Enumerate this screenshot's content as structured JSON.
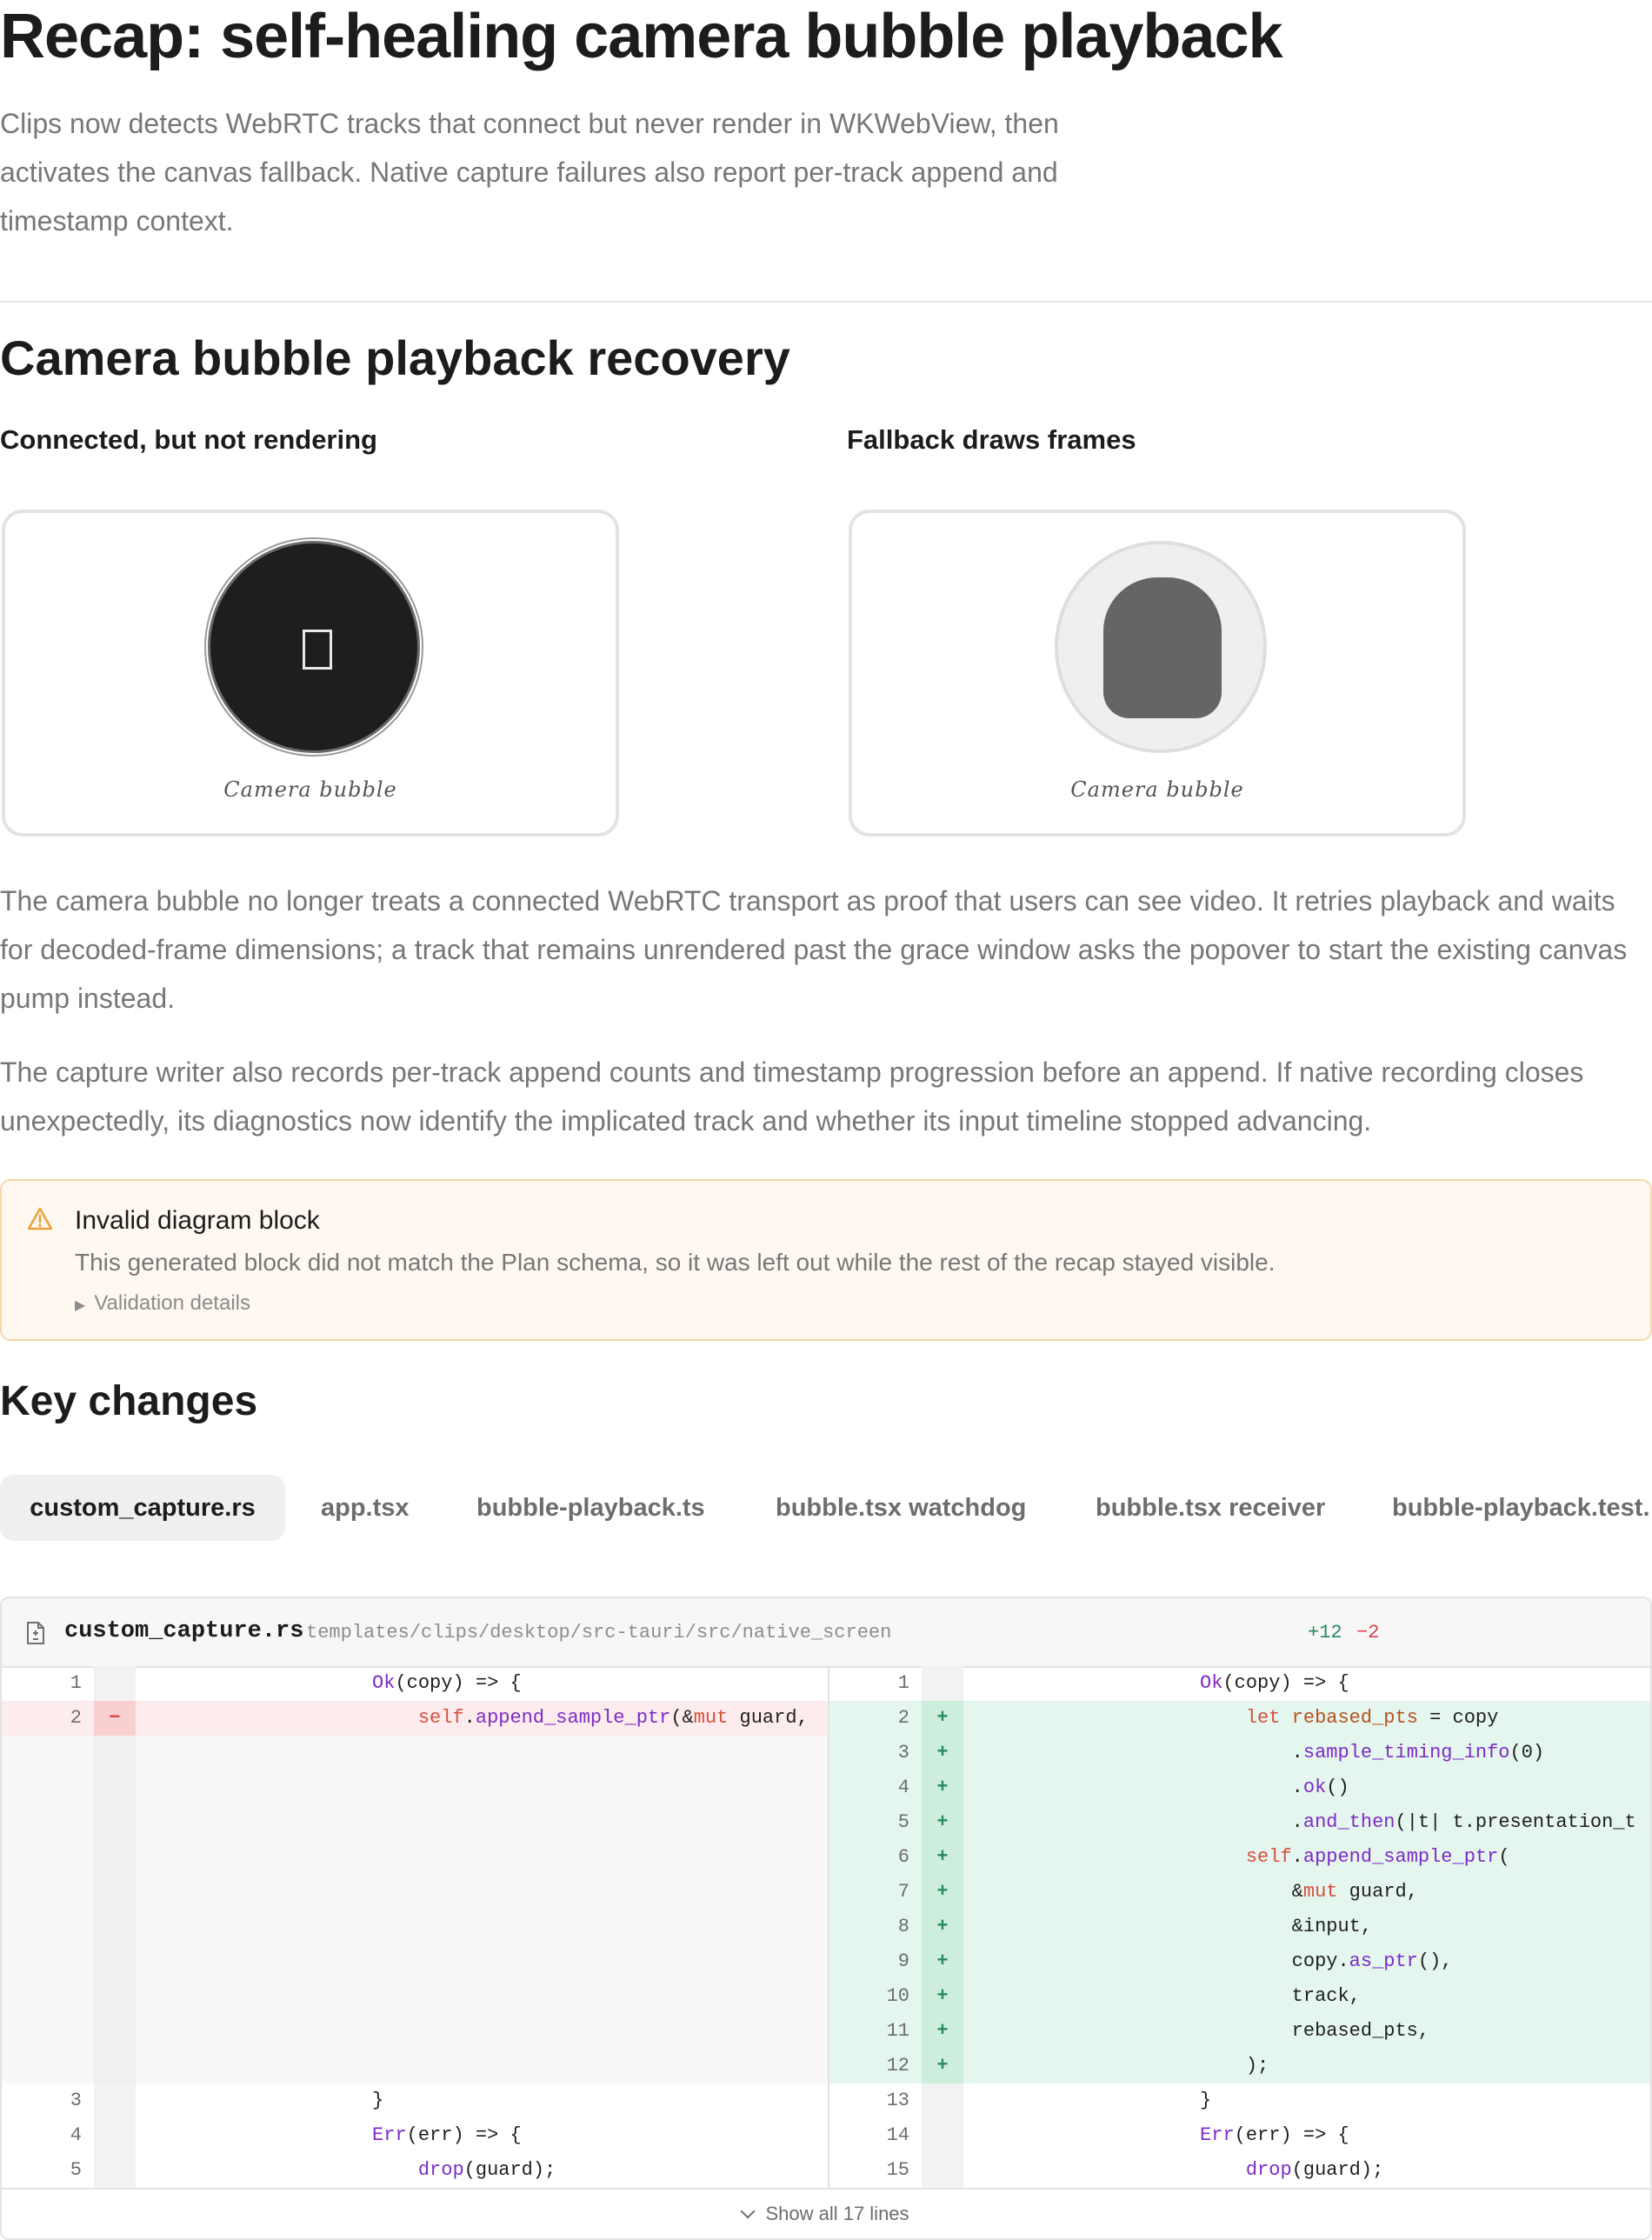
{
  "page": {
    "title": "Recap: self-healing camera bubble playback",
    "intro": "Clips now detects WebRTC tracks that connect but never render in WKWebView, then activates the canvas fallback. Native capture failures also report per-track append and timestamp context."
  },
  "section": {
    "heading": "Camera bubble playback recovery",
    "left_caption": "Connected, but not rendering",
    "right_caption": "Fallback draws frames",
    "left_bubble_label": "Camera bubble",
    "right_bubble_label": "Camera bubble",
    "paragraph1": "The camera bubble no longer treats a connected WebRTC transport as proof that users can see video. It retries playback and waits for decoded-frame dimensions; a track that remains unrendered past the grace window asks the popover to start the existing canvas pump instead.",
    "paragraph2": "The capture writer also records per-track append counts and timestamp progression before an append. If native recording closes unexpectedly, its diagnostics now identify the implicated track and whether its input timeline stopped advancing."
  },
  "warning": {
    "title": "Invalid diagram block",
    "description": "This generated block did not match the Plan schema, so it was left out while the rest of the recap stayed visible.",
    "details_label": "Validation details",
    "accent_color": "#e8a33c"
  },
  "key_changes": {
    "heading": "Key changes",
    "tabs": [
      "custom_capture.rs",
      "app.tsx",
      "bubble-playback.ts",
      "bubble.tsx watchdog",
      "bubble.tsx receiver",
      "bubble-playback.test."
    ],
    "active_tab": "custom_capture.rs"
  },
  "diff": {
    "file_name": "custom_capture.rs",
    "file_path": "templates/clips/desktop/src-tauri/src/native_screen",
    "additions": "+12",
    "deletions": "−2",
    "show_all": "Show all 17 lines",
    "colors": {
      "added": "#e5f6ee",
      "removed": "#fdeced"
    },
    "left_lines": [
      {
        "num": "1",
        "type": "ctx",
        "text": "                    Ok(copy) => {"
      },
      {
        "num": "2",
        "type": "del",
        "text": "                        self.append_sample_ptr(&mut guard,"
      },
      {
        "num": "",
        "type": "empty",
        "text": ""
      },
      {
        "num": "",
        "type": "empty",
        "text": ""
      },
      {
        "num": "",
        "type": "empty",
        "text": ""
      },
      {
        "num": "",
        "type": "empty",
        "text": ""
      },
      {
        "num": "",
        "type": "empty",
        "text": ""
      },
      {
        "num": "",
        "type": "empty",
        "text": ""
      },
      {
        "num": "",
        "type": "empty",
        "text": ""
      },
      {
        "num": "",
        "type": "empty",
        "text": ""
      },
      {
        "num": "",
        "type": "empty",
        "text": ""
      },
      {
        "num": "",
        "type": "empty",
        "text": ""
      },
      {
        "num": "3",
        "type": "ctx",
        "text": "                    }"
      },
      {
        "num": "4",
        "type": "ctx",
        "text": "                    Err(err) => {"
      },
      {
        "num": "5",
        "type": "ctx",
        "text": "                        drop(guard);"
      }
    ],
    "right_lines": [
      {
        "num": "1",
        "type": "ctx",
        "text": "                    Ok(copy) => {"
      },
      {
        "num": "2",
        "type": "add",
        "text": "                        let rebased_pts = copy"
      },
      {
        "num": "3",
        "type": "add",
        "text": "                            .sample_timing_info(0)"
      },
      {
        "num": "4",
        "type": "add",
        "text": "                            .ok()"
      },
      {
        "num": "5",
        "type": "add",
        "text": "                            .and_then(|t| t.presentation_t"
      },
      {
        "num": "6",
        "type": "add",
        "text": "                        self.append_sample_ptr("
      },
      {
        "num": "7",
        "type": "add",
        "text": "                            &mut guard,"
      },
      {
        "num": "8",
        "type": "add",
        "text": "                            &input,"
      },
      {
        "num": "9",
        "type": "add",
        "text": "                            copy.as_ptr(),"
      },
      {
        "num": "10",
        "type": "add",
        "text": "                            track,"
      },
      {
        "num": "11",
        "type": "add",
        "text": "                            rebased_pts,"
      },
      {
        "num": "12",
        "type": "add",
        "text": "                        );"
      },
      {
        "num": "13",
        "type": "ctx",
        "text": "                    }"
      },
      {
        "num": "14",
        "type": "ctx",
        "text": "                    Err(err) => {"
      },
      {
        "num": "15",
        "type": "ctx",
        "text": "                        drop(guard);"
      }
    ]
  },
  "icons": {
    "warning": "warning-triangle-icon",
    "file": "file-diff-icon",
    "show_all": "chevron-down-icon",
    "details": "disclosure-triangle-icon"
  }
}
